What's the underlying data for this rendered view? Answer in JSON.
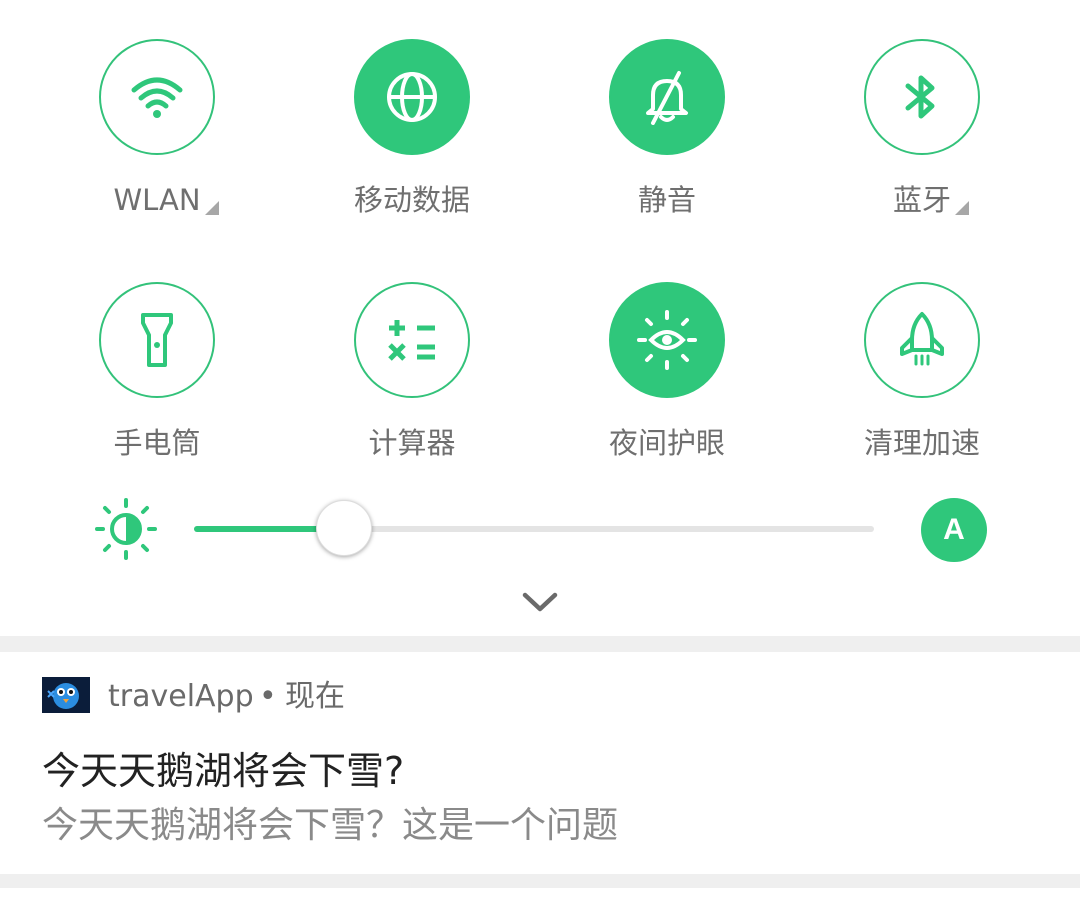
{
  "colors": {
    "accent": "#2fc77b",
    "label": "#6f6f6f",
    "track": "#e4e4e4"
  },
  "tiles": [
    {
      "label": "WLAN",
      "icon": "wifi-icon",
      "active": false,
      "has_menu": true
    },
    {
      "label": "移动数据",
      "icon": "globe-icon",
      "active": true,
      "has_menu": false
    },
    {
      "label": "静音",
      "icon": "bell-off-icon",
      "active": true,
      "has_menu": false
    },
    {
      "label": "蓝牙",
      "icon": "bluetooth-icon",
      "active": false,
      "has_menu": true
    },
    {
      "label": "手电筒",
      "icon": "flashlight-icon",
      "active": false,
      "has_menu": false
    },
    {
      "label": "计算器",
      "icon": "calculator-icon",
      "active": false,
      "has_menu": false
    },
    {
      "label": "夜间护眼",
      "icon": "eye-care-icon",
      "active": true,
      "has_menu": false
    },
    {
      "label": "清理加速",
      "icon": "rocket-icon",
      "active": false,
      "has_menu": false
    }
  ],
  "brightness": {
    "value_fraction": 0.22,
    "auto_label": "A",
    "icon": "brightness-icon"
  },
  "expand_icon": "chevron-down-icon",
  "notification": {
    "app_name": "travelApp",
    "separator": "•",
    "time": "现在",
    "title": "今天天鹅湖将会下雪?",
    "body": "今天天鹅湖将会下雪？这是一个问题"
  }
}
